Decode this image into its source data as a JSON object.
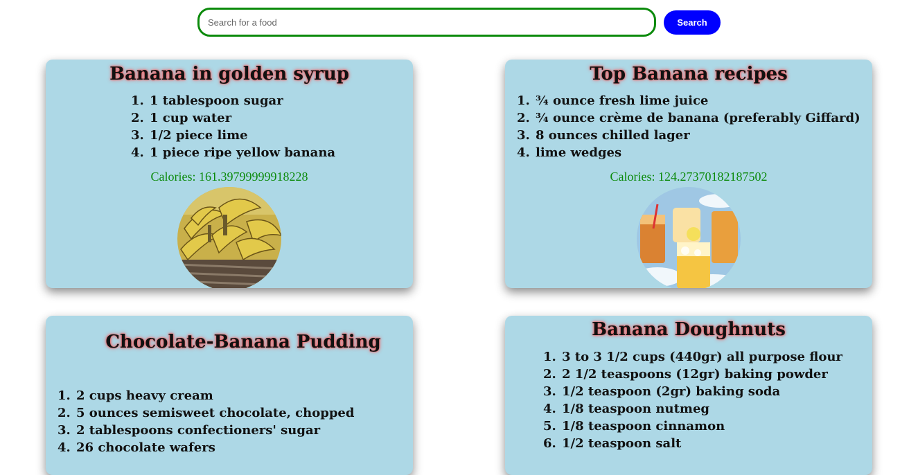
{
  "search": {
    "placeholder": "Search for a food",
    "button_label": "Search",
    "border_color": "#0b8a0b",
    "button_color": "#0000ff"
  },
  "recipes": [
    {
      "title": "Banana in golden syrup",
      "ingredients": [
        "1 tablespoon sugar",
        "1 cup water",
        "1/2 piece lime",
        "1 piece ripe yellow banana"
      ],
      "calories": "Calories: 161.39799999918228",
      "image": "bananas-basket-photo"
    },
    {
      "title": "Top Banana recipes",
      "ingredients": [
        "¾ ounce fresh lime juice",
        "¾ ounce crème de banana (preferably Giffard)",
        "8 ounces chilled lager",
        "lime wedges"
      ],
      "calories": "Calories: 124.27370182187502",
      "image": "cocktail-glasses-photo"
    },
    {
      "title": "Chocolate-Banana Pudding",
      "ingredients": [
        "2 cups heavy cream",
        "5 ounces semisweet chocolate, chopped",
        "2 tablespoons confectioners' sugar",
        "26 chocolate wafers"
      ]
    },
    {
      "title": "Banana Doughnuts",
      "ingredients": [
        "3 to 3 1/2 cups (440gr) all purpose flour",
        "2 1/2 teaspoons (12gr) baking powder",
        "1/2 teaspoon (2gr) baking soda",
        "1/8 teaspoon nutmeg",
        "1/8 teaspoon cinnamon",
        "1/2 teaspoon salt"
      ]
    }
  ],
  "colors": {
    "card_background": "#add8e6",
    "calories_text": "#0b8a0b",
    "title_glow": "#ff4b4b"
  }
}
